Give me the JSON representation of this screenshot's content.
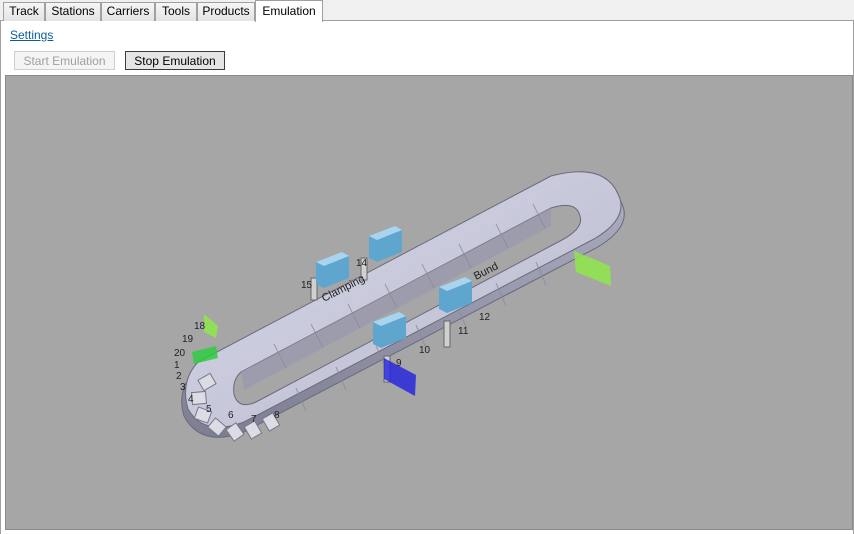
{
  "tabs": [
    {
      "label": "Track"
    },
    {
      "label": "Stations"
    },
    {
      "label": "Carriers"
    },
    {
      "label": "Tools"
    },
    {
      "label": "Products"
    },
    {
      "label": "Emulation"
    }
  ],
  "settings_link": "Settings",
  "buttons": {
    "start": "Start Emulation",
    "stop": "Stop Emulation"
  },
  "scene": {
    "station_labels": {
      "clamping": "Clamping",
      "second": "Bund"
    },
    "numbers": {
      "n14": "14",
      "n15": "15",
      "n10": "10",
      "n11": "11",
      "n12": "12",
      "n9": "9",
      "n19": "19",
      "n20": "20",
      "n18": "18",
      "n1": "1",
      "n2": "2",
      "n3": "3",
      "n4": "4",
      "n5": "5",
      "n6": "6",
      "n7": "7",
      "n8": "8"
    },
    "colors": {
      "background": "#a6a6a6",
      "track": "#c8c8dc",
      "carrier": "#72b4d8",
      "marker_green": "#8ee84a",
      "marker_blue": "#2020e0"
    }
  }
}
